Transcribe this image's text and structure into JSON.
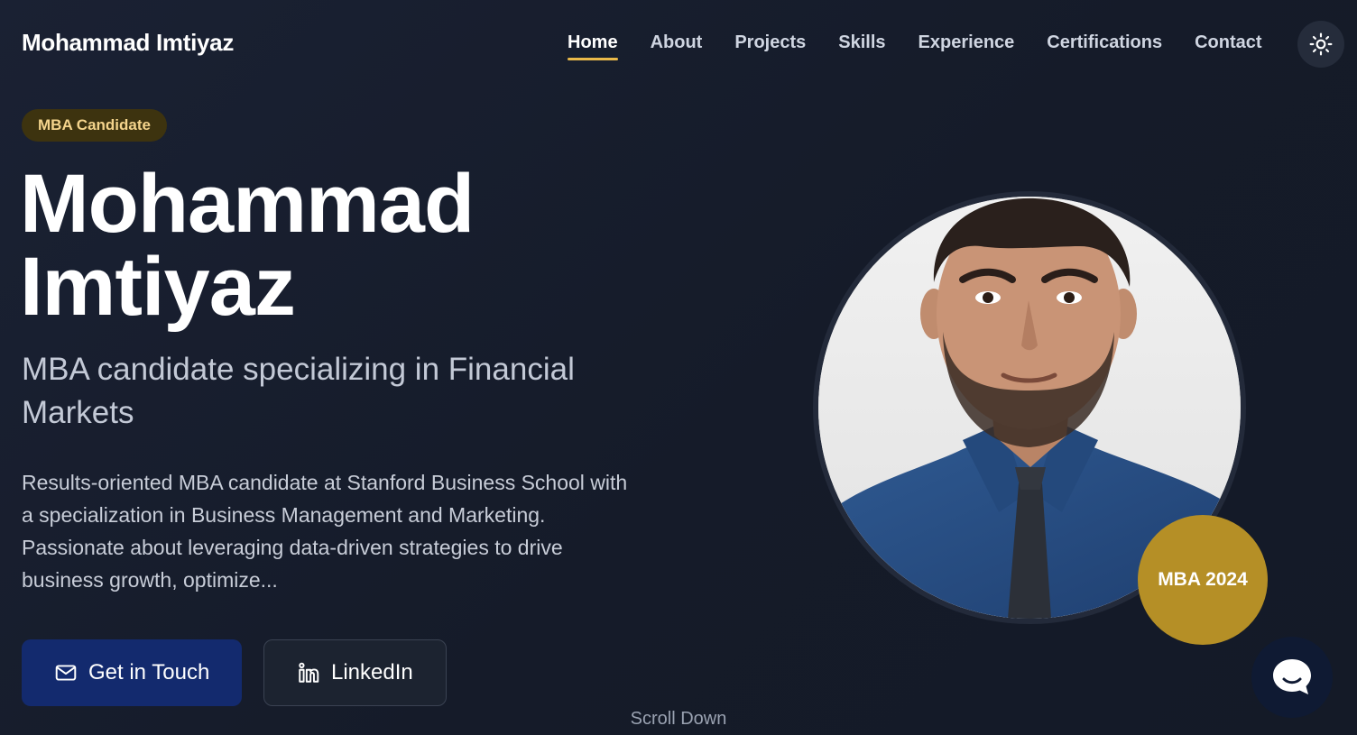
{
  "header": {
    "brand": "Mohammad Imtiyaz",
    "nav": [
      {
        "label": "Home",
        "active": true
      },
      {
        "label": "About"
      },
      {
        "label": "Projects"
      },
      {
        "label": "Skills"
      },
      {
        "label": "Experience"
      },
      {
        "label": "Certifications"
      },
      {
        "label": "Contact"
      }
    ],
    "theme_icon": "sun-icon"
  },
  "hero": {
    "badge": "MBA Candidate",
    "name_line1": "Mohammad",
    "name_line2": "Imtiyaz",
    "subtitle": "MBA candidate specializing in Financial Markets",
    "description": "Results-oriented MBA candidate at Stanford Business School with a specialization in Business Management and Marketing. Passionate about leveraging data-driven strategies to drive business growth, optimize...",
    "primary_button": {
      "label": "Get in Touch",
      "icon": "mail-icon"
    },
    "secondary_button": {
      "label": "LinkedIn",
      "icon": "linkedin-icon"
    },
    "portrait_badge": "MBA 2024",
    "scroll_hint": "Scroll Down"
  },
  "chat": {
    "icon": "chat-bubble-icon"
  },
  "colors": {
    "accent": "#e9b949",
    "badge_gold": "#b58f26",
    "primary_button": "#132a6e",
    "background": "#161c2b"
  }
}
